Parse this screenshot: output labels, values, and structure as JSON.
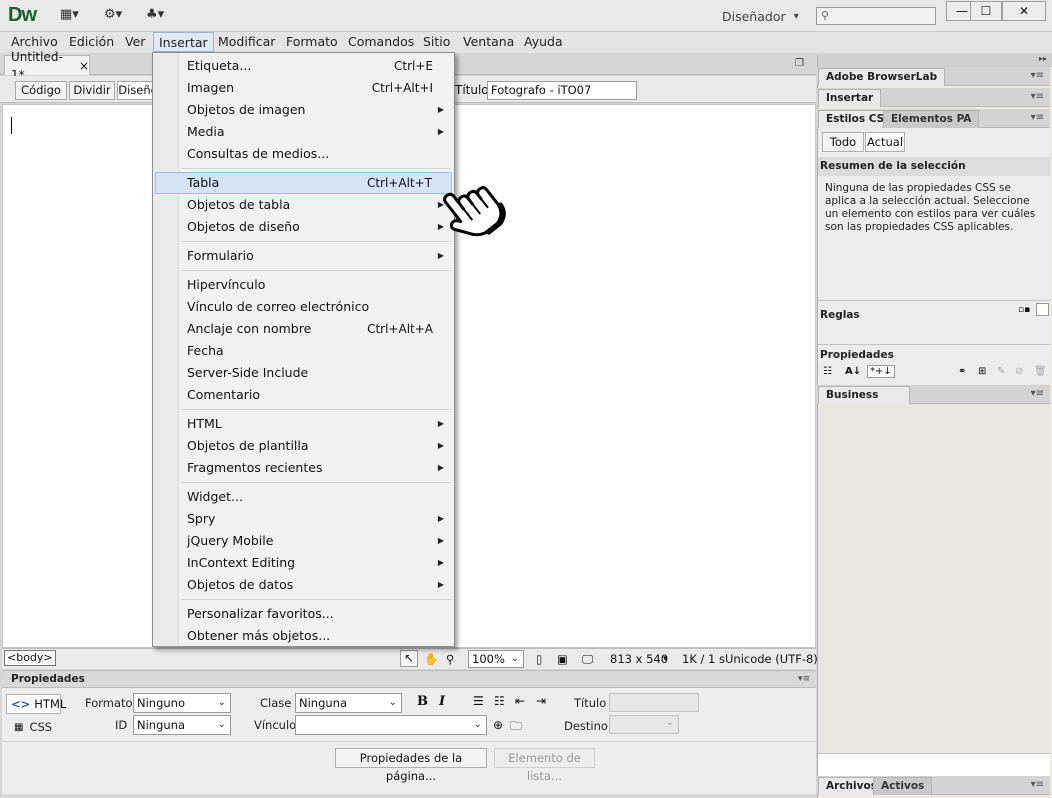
{
  "app": {
    "logo": "Dw",
    "workspace": "Diseñador",
    "workspace_arrow": "▾"
  },
  "window_controls": {
    "minimize": "—",
    "maximize": "☐",
    "close": "✕"
  },
  "menubar": [
    {
      "label": "Archivo"
    },
    {
      "label": "Edición"
    },
    {
      "label": "Ver"
    },
    {
      "label": "Insertar"
    },
    {
      "label": "Modificar"
    },
    {
      "label": "Formato"
    },
    {
      "label": "Comandos"
    },
    {
      "label": "Sitio"
    },
    {
      "label": "Ventana"
    },
    {
      "label": "Ayuda"
    }
  ],
  "document": {
    "tab_label": "Untitled-1*",
    "tab_close": "×",
    "view_buttons": [
      "Código",
      "Dividir",
      "Diseño"
    ],
    "title_label": "Título:",
    "title_value": "Fotografo - iTO07"
  },
  "statusbar": {
    "tag": "<body>",
    "zoom": "100%",
    "size": "813 x 540",
    "filesize": "1K / 1 s",
    "encoding": "Unicode (UTF-8)"
  },
  "insert_menu": [
    {
      "label": "Etiqueta...",
      "shortcut": "Ctrl+E",
      "submenu": false
    },
    {
      "label": "Imagen",
      "shortcut": "Ctrl+Alt+I",
      "submenu": false
    },
    {
      "label": "Objetos de imagen",
      "shortcut": "",
      "submenu": true
    },
    {
      "label": "Media",
      "shortcut": "",
      "submenu": true
    },
    {
      "label": "Consultas de medios...",
      "shortcut": "",
      "submenu": false,
      "sep_after": true
    },
    {
      "label": "Tabla",
      "shortcut": "Ctrl+Alt+T",
      "submenu": false,
      "highlighted": true
    },
    {
      "label": "Objetos de tabla",
      "shortcut": "",
      "submenu": true
    },
    {
      "label": "Objetos de diseño",
      "shortcut": "",
      "submenu": true,
      "sep_after": true
    },
    {
      "label": "Formulario",
      "shortcut": "",
      "submenu": true,
      "sep_after": true
    },
    {
      "label": "Hipervínculo",
      "shortcut": "",
      "submenu": false
    },
    {
      "label": "Vínculo de correo electrónico",
      "shortcut": "",
      "submenu": false
    },
    {
      "label": "Anclaje con nombre",
      "shortcut": "Ctrl+Alt+A",
      "submenu": false
    },
    {
      "label": "Fecha",
      "shortcut": "",
      "submenu": false
    },
    {
      "label": "Server-Side Include",
      "shortcut": "",
      "submenu": false
    },
    {
      "label": "Comentario",
      "shortcut": "",
      "submenu": false,
      "sep_after": true
    },
    {
      "label": "HTML",
      "shortcut": "",
      "submenu": true
    },
    {
      "label": "Objetos de plantilla",
      "shortcut": "",
      "submenu": true
    },
    {
      "label": "Fragmentos recientes",
      "shortcut": "",
      "submenu": true,
      "sep_after": true
    },
    {
      "label": "Widget...",
      "shortcut": "",
      "submenu": false
    },
    {
      "label": "Spry",
      "shortcut": "",
      "submenu": true
    },
    {
      "label": "jQuery Mobile",
      "shortcut": "",
      "submenu": true
    },
    {
      "label": "InContext Editing",
      "shortcut": "",
      "submenu": true
    },
    {
      "label": "Objetos de datos",
      "shortcut": "",
      "submenu": true,
      "sep_after": true
    },
    {
      "label": "Personalizar favoritos...",
      "shortcut": "",
      "submenu": false
    },
    {
      "label": "Obtener más objetos...",
      "shortcut": "",
      "submenu": false
    }
  ],
  "properties": {
    "header": "Propiedades",
    "html_btn": "HTML",
    "css_btn": "CSS",
    "formato_label": "Formato",
    "formato_value": "Ninguno",
    "clase_label": "Clase",
    "clase_value": "Ninguna",
    "id_label": "ID",
    "id_value": "Ninguna",
    "vinculo_label": "Vínculo",
    "titulo_label": "Título",
    "destino_label": "Destino",
    "page_props_btn": "Propiedades de la página...",
    "list_item_btn": "Elemento de lista..."
  },
  "right_panels": {
    "browserlab": "Adobe BrowserLab",
    "insertar": "Insertar",
    "estilos_css": "Estilos CSS",
    "elementos_pa": "Elementos PA",
    "todo": "Todo",
    "actual": "Actual",
    "summary_title": "Resumen de la selección",
    "summary_text": "Ninguna de las propiedades CSS se aplica a la selección actual.  Seleccione un elemento con estilos para ver cuáles son las propiedades CSS aplicables.",
    "reglas": "Reglas",
    "propiedades": "Propiedades",
    "business_catalyst": "Business Catalyst",
    "archivos": "Archivos",
    "activos": "Activos"
  },
  "colors": {
    "menu_highlight": "#d2e4f5",
    "logo": "#1f5c2a"
  }
}
